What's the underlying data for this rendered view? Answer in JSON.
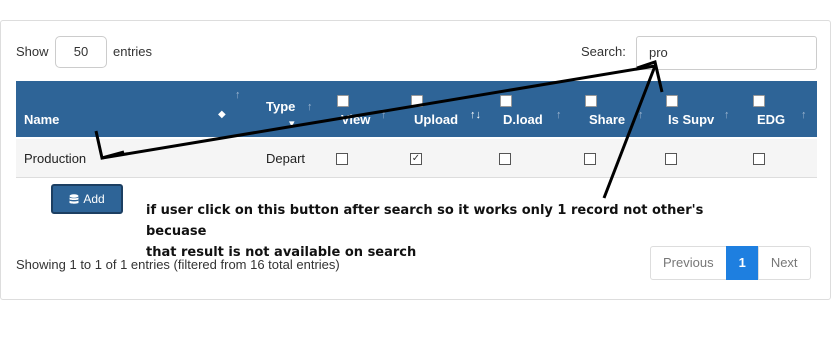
{
  "controls": {
    "show_label": "Show",
    "entries_value": "50",
    "entries_label": "entries",
    "search_label": "Search:",
    "search_value": "pro"
  },
  "table": {
    "headers": {
      "name": "Name",
      "type": "Type",
      "view": "View",
      "upload": "Upload",
      "dload": "D.load",
      "share": "Share",
      "is_supv": "Is Supv",
      "edg": "EDG"
    },
    "rows": [
      {
        "name": "Production",
        "type": "Depart",
        "view": false,
        "upload": true,
        "dload": false,
        "share": false,
        "is_supv": false,
        "edg": false
      }
    ]
  },
  "add_button": {
    "label": "Add",
    "icon": "database-icon"
  },
  "annotation": {
    "line1": "if user click on this button after search so it works only 1 record not other's becuase",
    "line2": "that result is not available on search",
    "arrow_color": "#000000"
  },
  "footer": {
    "info": "Showing 1 to 1 of 1 entries (filtered from 16 total entries)",
    "pagination": {
      "previous": "Previous",
      "current": "1",
      "next": "Next"
    }
  },
  "colors": {
    "header_bg": "#2e6497",
    "active_page": "#1e7fe0"
  }
}
